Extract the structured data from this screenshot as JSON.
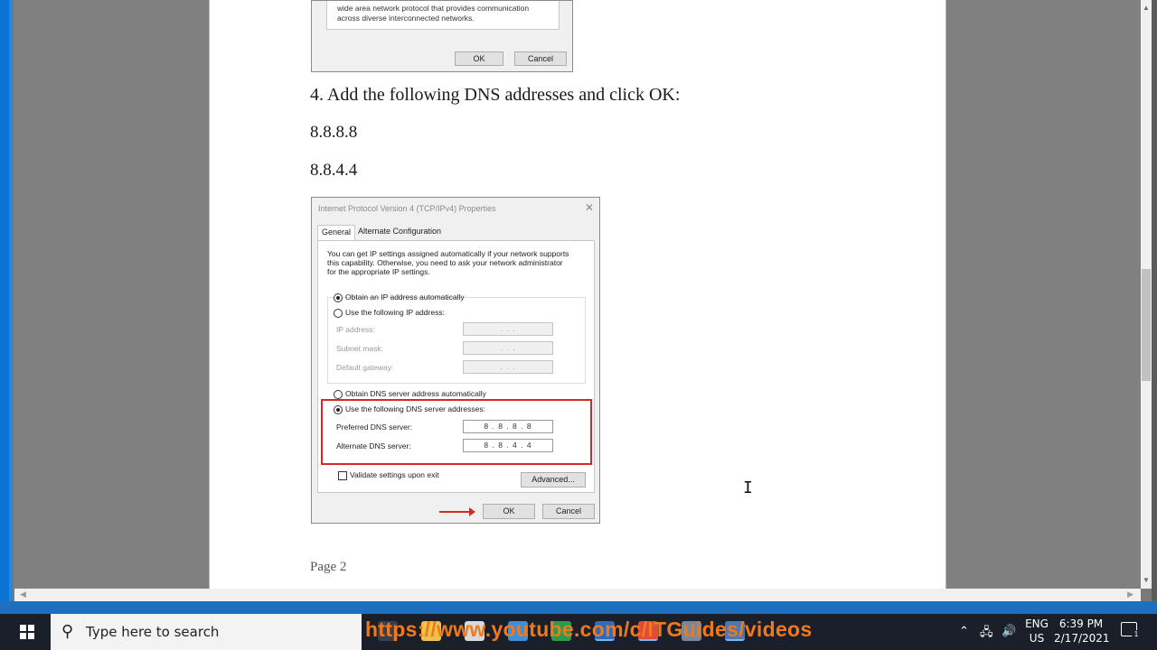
{
  "document": {
    "top_dialog": {
      "description_line1": "wide area network protocol that provides communication",
      "description_line2": "across diverse interconnected networks.",
      "ok_label": "OK",
      "cancel_label": "Cancel"
    },
    "step_text": "4. Add the following DNS addresses and click OK:",
    "dns_primary": "8.8.8.8",
    "dns_secondary": "8.8.4.4",
    "page_label": "Page 2"
  },
  "ipv4_dialog": {
    "title": "Internet Protocol Version 4 (TCP/IPv4) Properties",
    "close_glyph": "✕",
    "tabs": [
      {
        "label": "General"
      },
      {
        "label": "Alternate Configuration"
      }
    ],
    "intro_line1": "You can get IP settings assigned automatically if your network supports",
    "intro_line2": "this capability. Otherwise, you need to ask your network administrator",
    "intro_line3": "for the appropriate IP settings.",
    "obtain_ip_auto": "Obtain an IP address automatically",
    "use_following_ip": "Use the following IP address:",
    "ip_address_label": "IP address:",
    "subnet_mask_label": "Subnet mask:",
    "default_gateway_label": "Default gateway:",
    "empty_ip": ".   .   .",
    "obtain_dns_auto": "Obtain DNS server address automatically",
    "use_following_dns": "Use the following DNS server addresses:",
    "preferred_dns_label": "Preferred DNS server:",
    "preferred_dns_value": "8 . 8 . 8 . 8",
    "alternate_dns_label": "Alternate DNS server:",
    "alternate_dns_value": "8 . 8 . 4 . 4",
    "validate_label": "Validate settings upon exit",
    "advanced_label": "Advanced...",
    "ok_label": "OK",
    "cancel_label": "Cancel"
  },
  "taskbar": {
    "search_placeholder": "Type here to search",
    "url_overlay": "https://www.youtube.com/c/ITGuides/videos",
    "language_line1": "ENG",
    "language_line2": "US",
    "time": "6:39 PM",
    "date": "2/17/2021",
    "notification_count": "1"
  },
  "colors": {
    "highlight_red": "#d62828",
    "overlay_orange": "#f07a1a",
    "taskbar": "#1b1f2a"
  }
}
